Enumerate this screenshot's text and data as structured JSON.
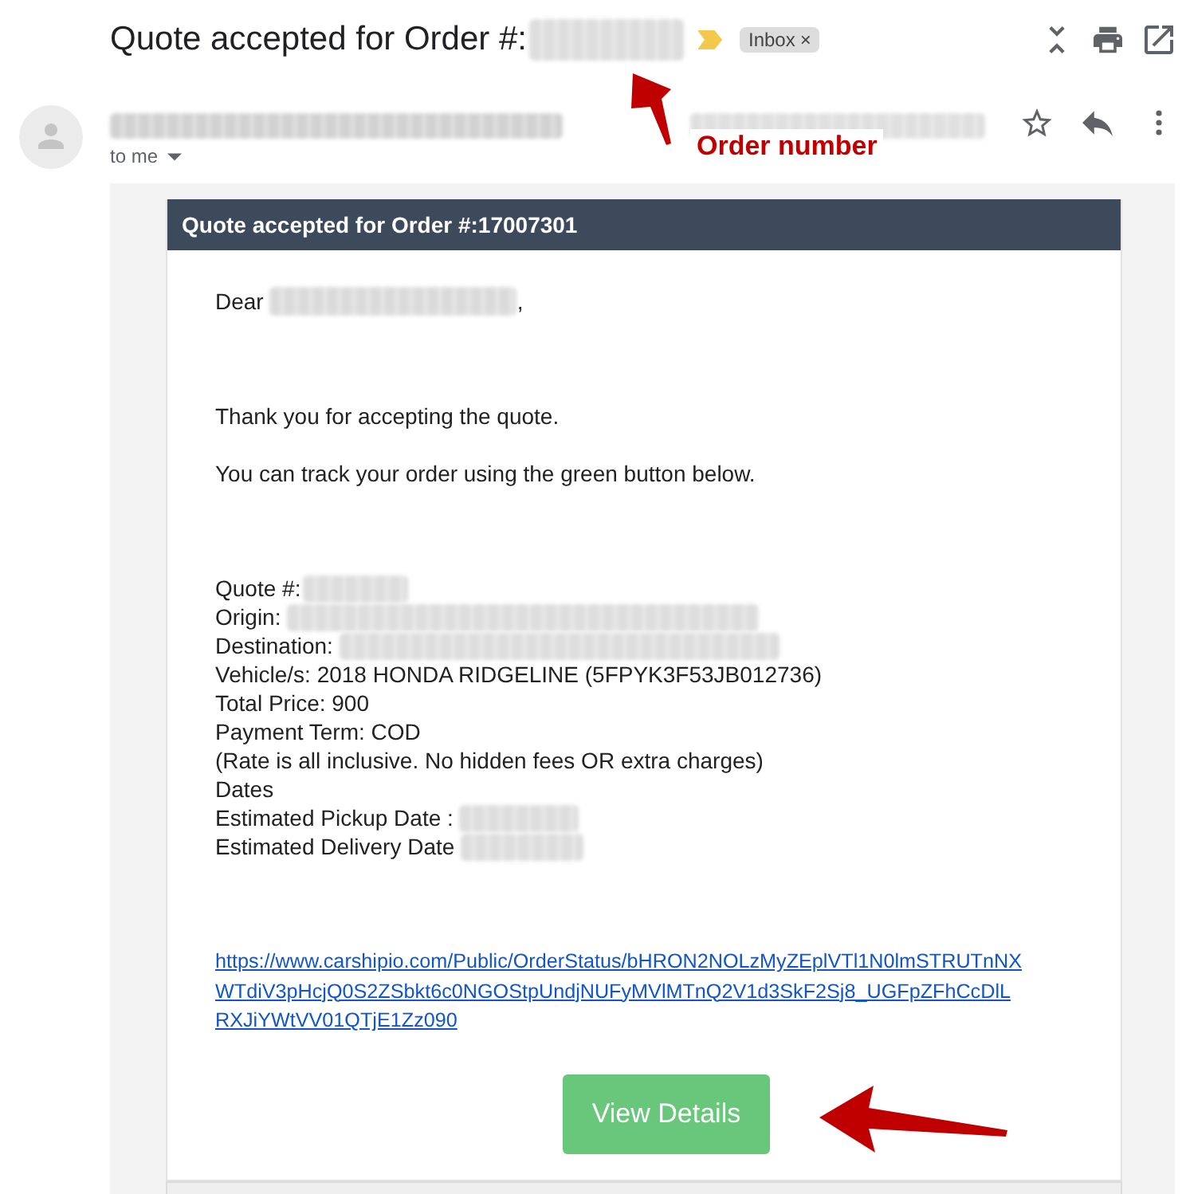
{
  "subject": {
    "text": "Quote accepted for Order #:",
    "number_redacted": true,
    "important": true,
    "labels": [
      {
        "text": "Inbox",
        "close": "×"
      }
    ]
  },
  "sender": {
    "name_redacted": true,
    "date_redacted": true,
    "recipient": "to me",
    "starred": false
  },
  "email": {
    "header": "Quote accepted for Order #:17007301",
    "greeting": {
      "text": "Dear",
      "redacted": true,
      "end": ","
    },
    "paragraphs": [
      "Thank you for accepting the quote.",
      "You can track your order using the green button below."
    ],
    "details": [
      {
        "text": "Quote #:",
        "redacted": true
      },
      {
        "text": "Origin:",
        "redacted": true
      },
      {
        "text": "Destination:",
        "redacted": true
      },
      {
        "text": "Vehicle/s: 2018 HONDA RIDGELINE (5FPYK3F53JB012736)",
        "redacted": false
      },
      {
        "text": "Total Price: 900",
        "redacted": false
      },
      {
        "text": "Payment Term: COD",
        "redacted": false
      },
      {
        "text": "(Rate is all inclusive. No hidden fees OR extra charges)",
        "redacted": false
      },
      {
        "text": "Dates",
        "redacted": false
      },
      {
        "text": "Estimated Pickup Date :",
        "redacted": true
      },
      {
        "text": "Estimated Delivery Date",
        "redacted": true
      }
    ],
    "link": "https://www.carshipio.com/Public/OrderStatus/bHRON2NOLzMyZEplVTl1N0lmSTRUTnNXWTdiV3pHcjQ0S2ZSbkt6c0NGOStpUndjNUFyMVlMTnQ2V1d3SkF2Sj8_UGFpZFhCcDlLRXJiYWtVV01QTjE1Zz090",
    "button": "View Details"
  },
  "annotation": {
    "label": "Order number"
  }
}
